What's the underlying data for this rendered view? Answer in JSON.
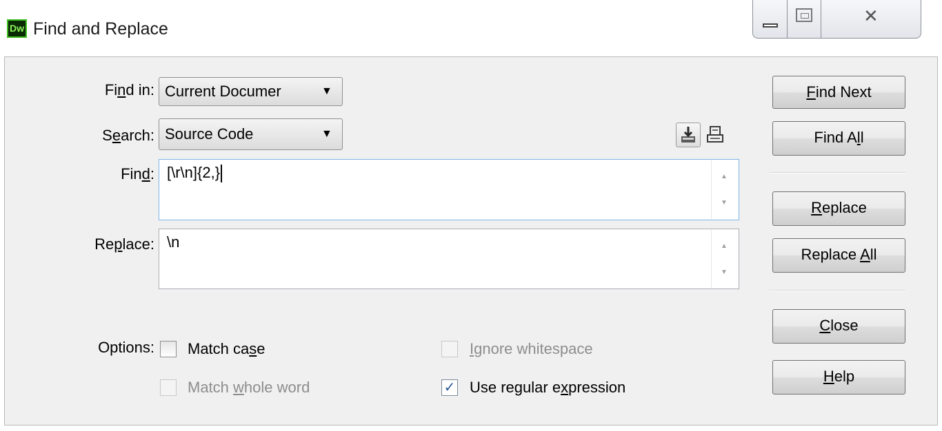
{
  "window": {
    "title": "Find and Replace",
    "app_logo": "Dw",
    "controls": {
      "minimize": "minimize-icon",
      "maximize": "maximize-icon",
      "close": "close-icon",
      "close_glyph": "✕"
    }
  },
  "labels": {
    "find_in": {
      "pre": "Fi",
      "key": "n",
      "post": "d in:"
    },
    "search": {
      "pre": "S",
      "key": "e",
      "post": "arch:"
    },
    "find": {
      "pre": "Fin",
      "key": "d",
      "post": ":"
    },
    "replace": {
      "pre": "Re",
      "key": "p",
      "post": "lace:"
    },
    "options": "Options:"
  },
  "find_in_select": {
    "value": "Current Documer",
    "arrow": "▼"
  },
  "search_select": {
    "value": "Source Code",
    "arrow": "▼"
  },
  "find_field": {
    "value": "[\\r\\n]{2,}"
  },
  "replace_field": {
    "value": "\\n"
  },
  "icons": {
    "save_query": "save-query-icon",
    "load_query": "load-query-icon"
  },
  "buttons": {
    "find_next": {
      "key": "F",
      "post": "ind Next"
    },
    "find_all": {
      "pre": "Find A",
      "key": "l",
      "post": "l"
    },
    "replace": {
      "key": "R",
      "post": "eplace"
    },
    "replace_all": {
      "pre": "Replace ",
      "key": "A",
      "post": "ll"
    },
    "close": {
      "key": "C",
      "post": "lose"
    },
    "help": {
      "key": "H",
      "post": "elp"
    }
  },
  "options": {
    "match_case": {
      "pre": "Match ca",
      "key": "s",
      "post": "e",
      "checked": false,
      "enabled": true
    },
    "ignore_whitespace": {
      "pre": "",
      "key": "I",
      "post": "gnore whitespace",
      "checked": false,
      "enabled": false
    },
    "match_whole_word": {
      "pre": "Match ",
      "key": "w",
      "post": "hole word",
      "checked": false,
      "enabled": false
    },
    "use_regex": {
      "pre": "Use regular e",
      "key": "x",
      "post": "pression",
      "checked": true,
      "enabled": true
    }
  },
  "colors": {
    "logo_bg": "#0a2a06",
    "logo_text": "#8df25a",
    "panel_bg": "#f0f0f0",
    "focus_border": "#7eb4ea",
    "disabled_text": "#8d8d8d",
    "check_color": "#2b5797"
  }
}
